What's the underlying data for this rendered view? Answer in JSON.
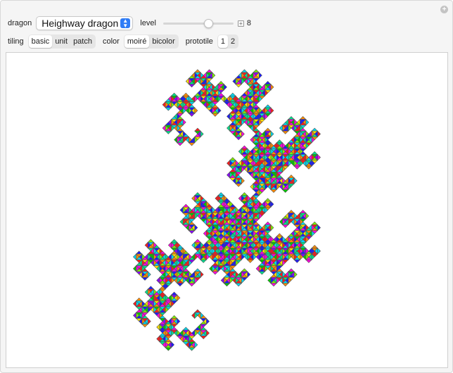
{
  "controls": {
    "dragon_label": "dragon",
    "dragon_value": "Heighway dragon",
    "level_label": "level",
    "level_value": "8",
    "level_fraction": 0.67,
    "tiling_label": "tiling",
    "tiling_options": [
      "basic",
      "unit",
      "patch"
    ],
    "tiling_selected": "basic",
    "color_label": "color",
    "color_options": [
      "moiré",
      "bicolor"
    ],
    "color_selected": "moiré",
    "prototile_label": "prototile",
    "prototile_options": [
      "1",
      "2"
    ],
    "prototile_selected": "1"
  },
  "palette": [
    "#ff1a1a",
    "#ff8c00",
    "#ffe000",
    "#7cf000",
    "#00c800",
    "#00e08c",
    "#00d8f0",
    "#0a8cff",
    "#1a1aff",
    "#8a00ff",
    "#ff00e0",
    "#ff0078"
  ],
  "icons": {
    "corner": "plus-circle-icon",
    "popup": "chevron-updown-icon",
    "slider_plus": "plus-square-icon"
  }
}
